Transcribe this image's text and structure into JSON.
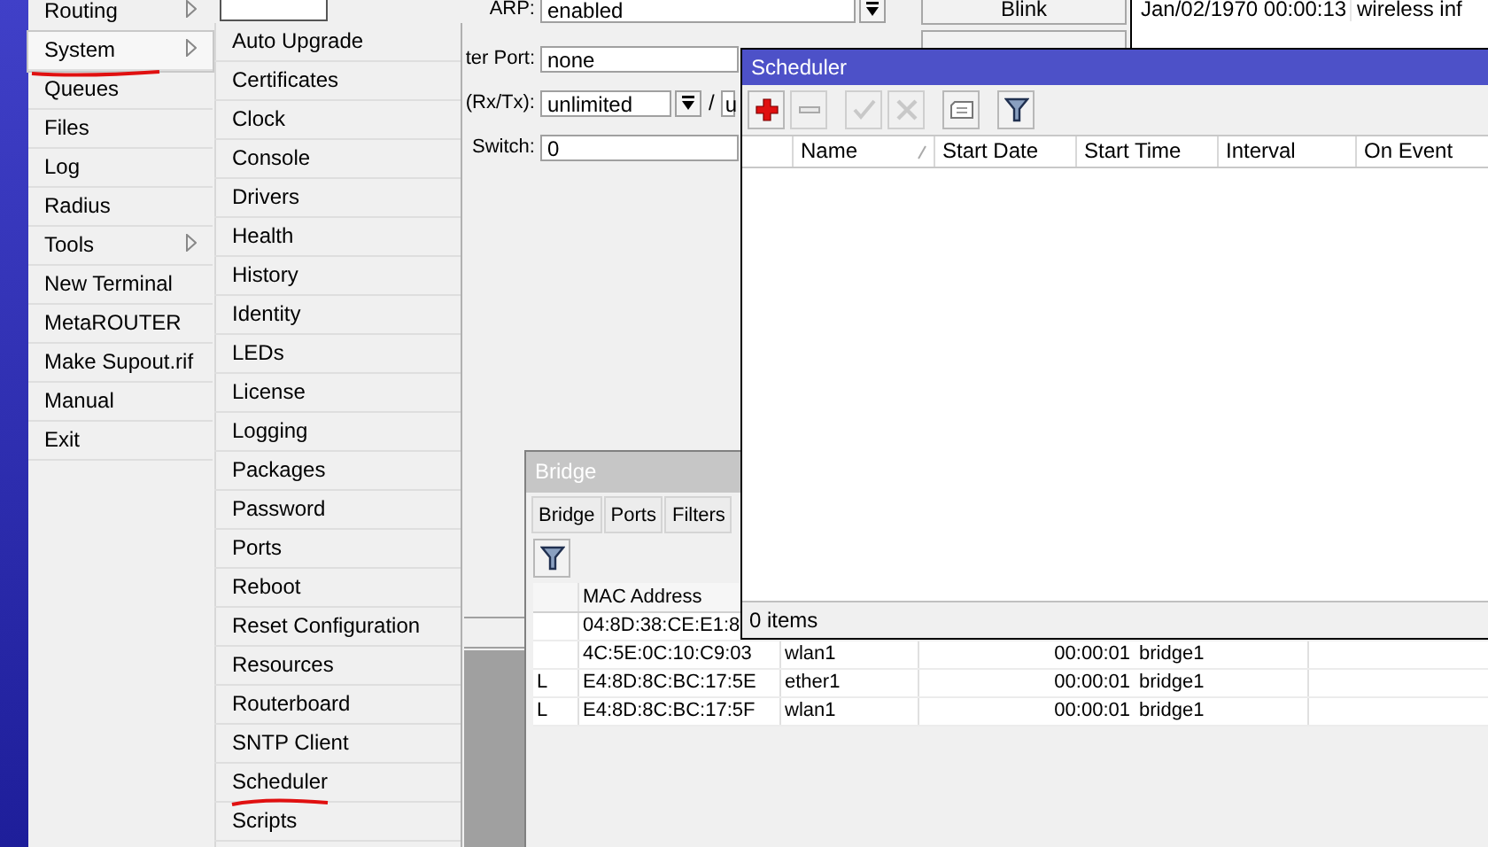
{
  "main_menu": {
    "items": [
      {
        "label": "Routing",
        "submenu": true,
        "selected": false,
        "underlined": false
      },
      {
        "label": "System",
        "submenu": true,
        "selected": true,
        "underlined": true
      },
      {
        "label": "Queues",
        "submenu": false,
        "selected": false,
        "underlined": false
      },
      {
        "label": "Files",
        "submenu": false,
        "selected": false,
        "underlined": false
      },
      {
        "label": "Log",
        "submenu": false,
        "selected": false,
        "underlined": false
      },
      {
        "label": "Radius",
        "submenu": false,
        "selected": false,
        "underlined": false
      },
      {
        "label": "Tools",
        "submenu": true,
        "selected": false,
        "underlined": false
      },
      {
        "label": "New Terminal",
        "submenu": false,
        "selected": false,
        "underlined": false
      },
      {
        "label": "MetaROUTER",
        "submenu": false,
        "selected": false,
        "underlined": false
      },
      {
        "label": "Make Supout.rif",
        "submenu": false,
        "selected": false,
        "underlined": false
      },
      {
        "label": "Manual",
        "submenu": false,
        "selected": false,
        "underlined": false
      },
      {
        "label": "Exit",
        "submenu": false,
        "selected": false,
        "underlined": false
      }
    ]
  },
  "system_submenu": {
    "items": [
      {
        "label": "Auto Upgrade",
        "underlined": false
      },
      {
        "label": "Certificates",
        "underlined": false
      },
      {
        "label": "Clock",
        "underlined": false
      },
      {
        "label": "Console",
        "underlined": false
      },
      {
        "label": "Drivers",
        "underlined": false
      },
      {
        "label": "Health",
        "underlined": false
      },
      {
        "label": "History",
        "underlined": false
      },
      {
        "label": "Identity",
        "underlined": false
      },
      {
        "label": "LEDs",
        "underlined": false
      },
      {
        "label": "License",
        "underlined": false
      },
      {
        "label": "Logging",
        "underlined": false
      },
      {
        "label": "Packages",
        "underlined": false
      },
      {
        "label": "Password",
        "underlined": false
      },
      {
        "label": "Ports",
        "underlined": false
      },
      {
        "label": "Reboot",
        "underlined": false
      },
      {
        "label": "Reset Configuration",
        "underlined": false
      },
      {
        "label": "Resources",
        "underlined": false
      },
      {
        "label": "Routerboard",
        "underlined": false
      },
      {
        "label": "SNTP Client",
        "underlined": false
      },
      {
        "label": "Scheduler",
        "underlined": true
      },
      {
        "label": "Scripts",
        "underlined": false
      }
    ]
  },
  "interface_window": {
    "fields": [
      {
        "label": "ARP:",
        "value": "enabled",
        "kind": "dropdown"
      },
      {
        "label": "ter Port:",
        "value": "none",
        "kind": "text"
      },
      {
        "label": "(Rx/Tx):",
        "value": "unlimited",
        "kind": "rate",
        "separator": "/",
        "value_2": "u"
      },
      {
        "label": "Switch:",
        "value": "0",
        "kind": "text"
      }
    ],
    "button": "Blink"
  },
  "log_panel": {
    "entries": [
      {
        "time": "Jan/02/1970 00:00:13",
        "message": "wireless inf"
      }
    ]
  },
  "bridge_window": {
    "title": "Bridge",
    "tabs": [
      "Bridge",
      "Ports",
      "Filters"
    ],
    "table": {
      "columns": {
        "mac_address": "MAC Address"
      },
      "rows": [
        {
          "mac_address": "04:8D:38:CE:E1:8"
        },
        {
          "mac_address": "4C:5E:0C:10:C9:03",
          "column_3": "wlan1",
          "column_5": "00:00:01",
          "column_6": "bridge1"
        },
        {
          "column_1": "L",
          "mac_address": "E4:8D:8C:BC:17:5E",
          "column_3": "ether1",
          "column_5": "00:00:01",
          "column_6": "bridge1"
        },
        {
          "column_1": "L",
          "mac_address": "E4:8D:8C:BC:17:5F",
          "column_3": "wlan1",
          "column_5": "00:00:01",
          "column_6": "bridge1"
        }
      ]
    }
  },
  "scheduler_window": {
    "title": "Scheduler",
    "toolbar": [
      {
        "kind": "add",
        "disabled": false
      },
      {
        "kind": "remove",
        "disabled": true
      },
      {
        "kind": "enable",
        "disabled": true
      },
      {
        "kind": "disable",
        "disabled": true
      },
      {
        "kind": "comment",
        "disabled": false
      },
      {
        "kind": "filter",
        "disabled": false
      }
    ],
    "columns": [
      "Name",
      "Start Date",
      "Start Time",
      "Interval",
      "On Event"
    ],
    "status": "0 items"
  }
}
